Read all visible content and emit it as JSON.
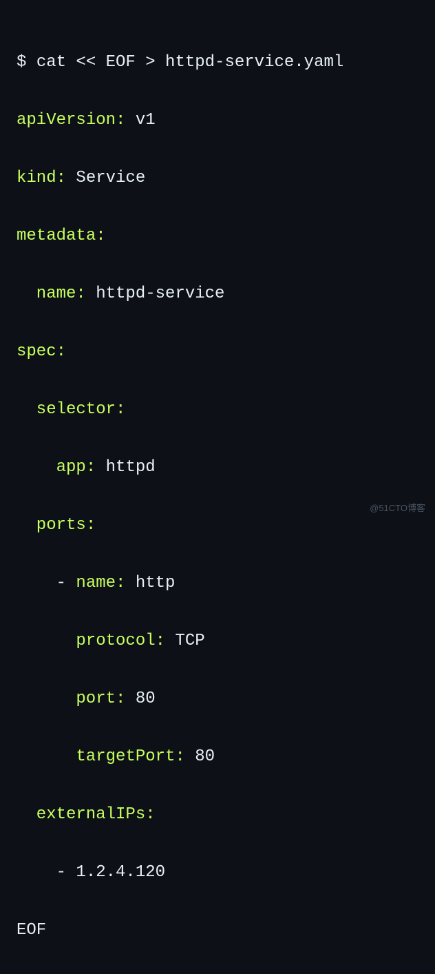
{
  "cmd": {
    "prompt": "$ ",
    "text": "cat << EOF > httpd-service.yaml"
  },
  "yaml": {
    "apiVersion": {
      "k": "apiVersion",
      "v": "v1"
    },
    "kind": {
      "k": "kind",
      "v": "Service"
    },
    "metadata": {
      "k": "metadata"
    },
    "metadata_name": {
      "k": "name",
      "v": "httpd-service"
    },
    "spec": {
      "k": "spec"
    },
    "selector": {
      "k": "selector"
    },
    "selector_app": {
      "k": "app",
      "v": "httpd"
    },
    "ports": {
      "k": "ports"
    },
    "port_name": {
      "k": "name",
      "v": "http"
    },
    "port_protocol": {
      "k": "protocol",
      "v": "TCP"
    },
    "port_port": {
      "k": "port",
      "v": "80"
    },
    "port_targetPort": {
      "k": "targetPort",
      "v": "80"
    },
    "externalIPs": {
      "k": "externalIPs"
    },
    "externalIPs_item": "1.2.4.120"
  },
  "eof": "EOF",
  "watermark": "@51CTO博客"
}
